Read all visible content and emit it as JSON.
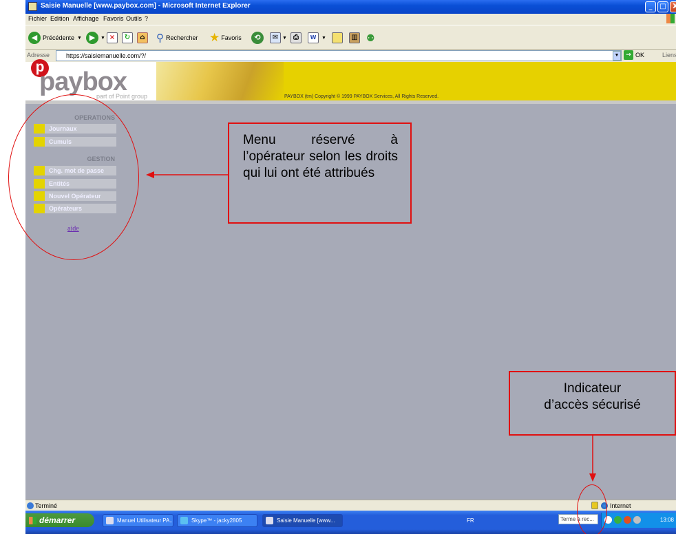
{
  "window": {
    "title": "Saisie Manuelle [www.paybox.com] - Microsoft Internet Explorer",
    "minimize": "_",
    "maximize": "□",
    "close": "X"
  },
  "menubar": {
    "items": [
      "Fichier",
      "Edition",
      "Affichage",
      "Favoris",
      "Outils",
      "?"
    ]
  },
  "toolbar": {
    "back_label": "Précédente",
    "search_label": "Rechercher",
    "favorites_label": "Favoris"
  },
  "address": {
    "label": "Adresse",
    "value": "https://saisiemanuelle.com/?/",
    "go_label": "OK",
    "links_label": "Liens"
  },
  "banner": {
    "logo": "paybox",
    "logo_letter": "p",
    "logo_tagline": "part of Point group",
    "copyright": "PAYBOX (tm) Copyright © 1999 PAYBOX Services, All Rights Reserved."
  },
  "sidebar": {
    "operations_title": "OPERATIONS",
    "operations_items": [
      "Journaux",
      "Cumuls"
    ],
    "gestion_title": "GESTION",
    "gestion_items": [
      "Chg. mot de passe",
      "Entités",
      "Nouvel Opérateur",
      "Opérateurs"
    ],
    "help_link": "aide"
  },
  "statusbar": {
    "status": "Terminé",
    "zone": "Internet"
  },
  "taskbar": {
    "start_label": "démarrer",
    "tasks": [
      "Manuel Utilisateur PA...",
      "Skype™ - jacky2805",
      "Saisie Manuelle [www..."
    ],
    "language": "FR",
    "search_value": "Terme à rec...",
    "clock": "13:08"
  },
  "annotations": {
    "menu_callout": "Menu réservé à l’opérateur selon les droits qui lui ont été attribués",
    "secure_callout_line1": "Indicateur",
    "secure_callout_line2": "d’accès sécurisé"
  },
  "colors": {
    "annotation": "#e01010",
    "banner_yellow": "#e6d100",
    "content_bg": "#a7aab7",
    "xp_blue": "#245edb"
  }
}
